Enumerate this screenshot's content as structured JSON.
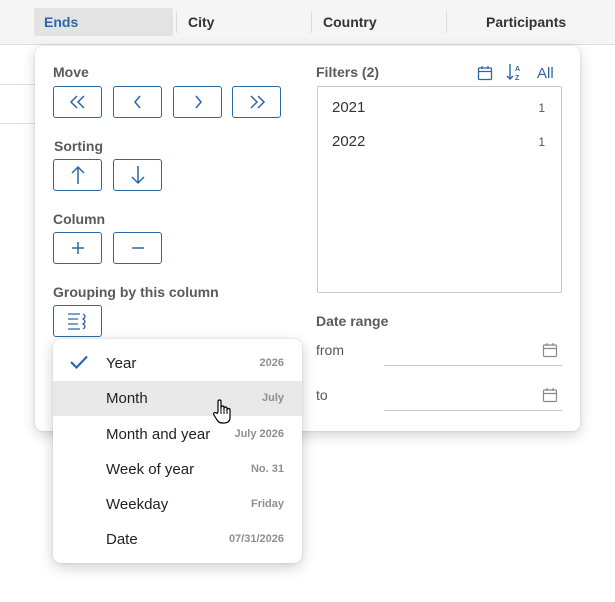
{
  "table": {
    "columns": [
      "Ends",
      "City",
      "Country",
      "Participants"
    ]
  },
  "popup": {
    "move_title": "Move",
    "sorting_title": "Sorting",
    "column_title": "Column",
    "grouping_title": "Grouping by this column",
    "filters_title": "Filters (2)",
    "all_label": "All",
    "filters": [
      {
        "value": "2021",
        "count": "1"
      },
      {
        "value": "2022",
        "count": "1"
      }
    ],
    "date_range_title": "Date range",
    "from_label": "from",
    "to_label": "to"
  },
  "grouping_menu": {
    "items": [
      {
        "label": "Year",
        "sample": "2026",
        "checked": true
      },
      {
        "label": "Month",
        "sample": "July",
        "checked": false
      },
      {
        "label": "Month and year",
        "sample": "July 2026",
        "checked": false
      },
      {
        "label": "Week of year",
        "sample": "No. 31",
        "checked": false
      },
      {
        "label": "Weekday",
        "sample": "Friday",
        "checked": false
      },
      {
        "label": "Date",
        "sample": "07/31/2026",
        "checked": false
      }
    ],
    "hovered_index": 1
  },
  "colors": {
    "accent": "#2c67a5",
    "header_bg": "#f5f5f5",
    "active_header_bg": "#e3e3e3",
    "hover_bg": "#e8e8e8"
  },
  "icons": {
    "move": [
      "double-chevron-left-icon",
      "chevron-left-icon",
      "chevron-right-icon",
      "double-chevron-right-icon"
    ],
    "sorting": [
      "arrow-up-icon",
      "arrow-down-icon"
    ],
    "column": [
      "plus-icon",
      "minus-icon"
    ],
    "grouping": "group-list-icon",
    "filters": [
      "calendar-icon",
      "sort-alpha-icon"
    ],
    "date": "calendar-icon"
  }
}
